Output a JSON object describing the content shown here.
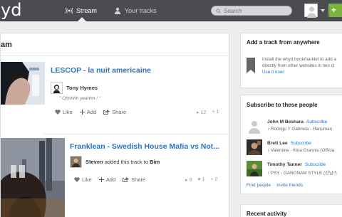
{
  "header": {
    "logo": "yd",
    "nav": [
      {
        "label": "Stream",
        "icon": "broadcast-icon",
        "active": true
      },
      {
        "label": "Your tracks",
        "icon": "user-icon",
        "active": false
      }
    ],
    "search_placeholder": "Search",
    "add_label": "+"
  },
  "feed": {
    "title": "am",
    "posts": [
      {
        "title": "LESCOP - la nuit americaine",
        "poster": "Tony Hymes",
        "quote": "\" Ohhhhh yeahhh ! \"",
        "actions": {
          "like": "Like",
          "add": "Add",
          "share": "Share"
        },
        "counts": {
          "plays": "12",
          "adds": "1"
        }
      },
      {
        "title": "Franklean - Swedish House Mafia vs Not...",
        "poster": "Steven",
        "added_text": "added this track to",
        "playlist": "Bim",
        "actions": {
          "like": "Like",
          "add": "Add",
          "share": "Share"
        },
        "counts": {
          "plays": "9",
          "likes": "1",
          "adds": "2"
        }
      }
    ]
  },
  "sidebar": {
    "add_track": {
      "title": "Add a track from anywhere",
      "text": "Install the whyd bookmarklet to add a directly from other websites in two cl",
      "link": "Use it now!"
    },
    "subscribe": {
      "title": "Subscribe to these people",
      "subscribe_label": "Subscribe",
      "people": [
        {
          "name": "John M Beshara",
          "track": "♪ Rodrigo Y Gabriela - Hanuman"
        },
        {
          "name": "Brett Lee",
          "track": "♪ Valentine - Kina Grannis (Officia"
        },
        {
          "name": "Timothy Tanner",
          "track": "♪ PSY - GANGNAM STYLE (강남스"
        }
      ],
      "find_people": "Find people",
      "invite_friends": "Invite friends"
    },
    "recent_activity": {
      "title": "Recent activity"
    }
  },
  "colors": {
    "topbar": "#4a4c4f",
    "link": "#2a73c0",
    "add_button": "#7ab53b",
    "background": "#eceef0"
  }
}
